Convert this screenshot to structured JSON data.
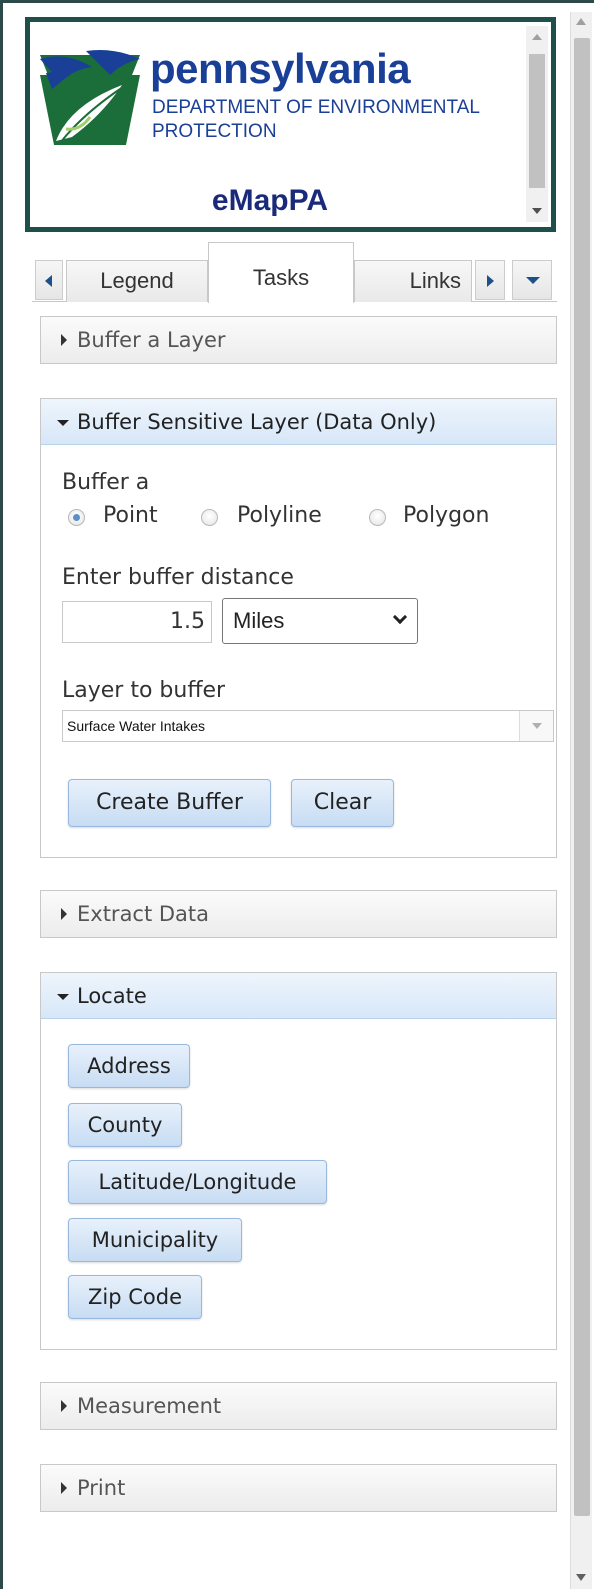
{
  "header": {
    "brand": "pennsylvania",
    "dept_line1": "DEPARTMENT OF ENVIRONMENTAL",
    "dept_line2": "PROTECTION",
    "app_name": "eMapPA"
  },
  "tabs": [
    {
      "label": "Legend",
      "active": false
    },
    {
      "label": "Tasks",
      "active": true
    },
    {
      "label": "Links",
      "active": false
    }
  ],
  "panels": {
    "buffer_layer": {
      "title": "Buffer a Layer"
    },
    "buffer_sensitive": {
      "title": "Buffer Sensitive Layer (Data Only)",
      "buffer_a_label": "Buffer a",
      "geometry_options": [
        {
          "label": "Point",
          "checked": true
        },
        {
          "label": "Polyline",
          "checked": false
        },
        {
          "label": "Polygon",
          "checked": false
        }
      ],
      "distance_label": "Enter buffer distance",
      "distance_value": "1.5",
      "unit_value": "Miles",
      "layer_label": "Layer to buffer",
      "layer_value": "Surface Water Intakes",
      "create_button": "Create Buffer",
      "clear_button": "Clear"
    },
    "extract": {
      "title": "Extract Data"
    },
    "locate": {
      "title": "Locate",
      "buttons": [
        "Address",
        "County",
        "Latitude/Longitude",
        "Municipality",
        "Zip Code"
      ]
    },
    "measurement": {
      "title": "Measurement"
    },
    "print": {
      "title": "Print"
    }
  },
  "colors": {
    "brand_blue": "#1a3f97",
    "frame_green": "#1f4f4a",
    "button_blue": "#c7dcf3"
  }
}
